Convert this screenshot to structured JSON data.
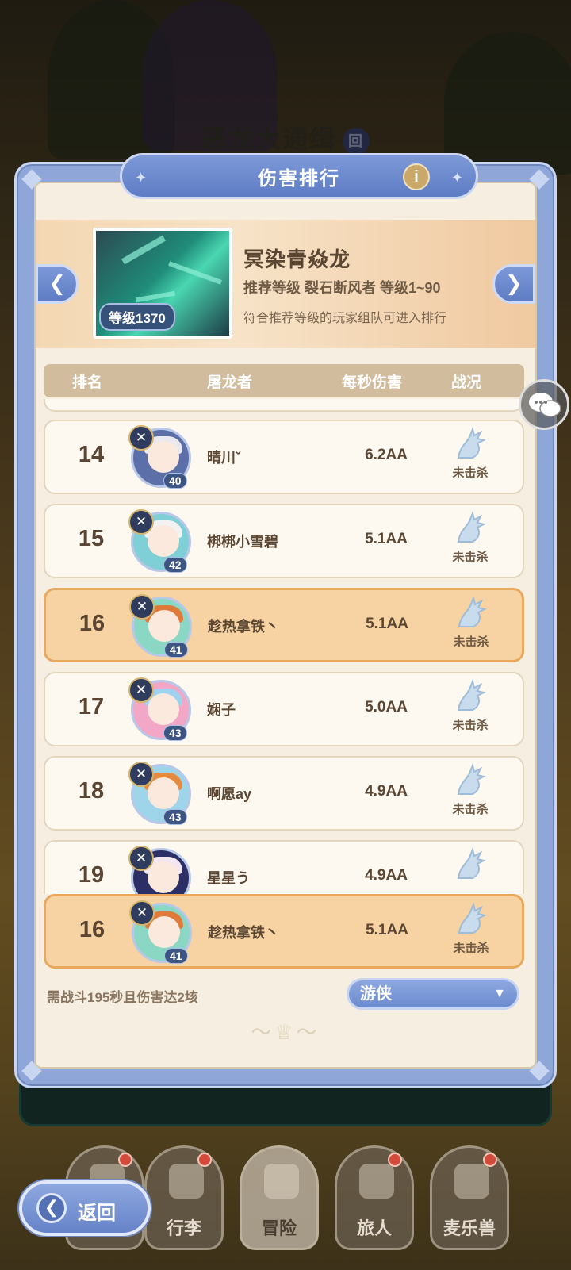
{
  "background": {
    "title": "恶龙大通缉",
    "badge": "回"
  },
  "modal": {
    "title": "伤害排行",
    "info_icon": "info-icon",
    "boss": {
      "name": "冥染青焱龙",
      "level_label": "等级1370",
      "recommend": "推荐等级  裂石断风者  等级1~90",
      "note": "符合推荐等级的玩家组队可进入排行"
    },
    "table_headers": {
      "rank": "排名",
      "player": "屠龙者",
      "dps": "每秒伤害",
      "status": "战况"
    },
    "rows": [
      {
        "rank": "14",
        "name": "晴川ˇ",
        "level": "40",
        "dps": "6.2AA",
        "status": "未击杀",
        "highlight": false,
        "hair": "#e9e9ef",
        "ring": "#5c6fa8"
      },
      {
        "rank": "15",
        "name": "梆梆小雪碧",
        "level": "42",
        "dps": "5.1AA",
        "status": "未击杀",
        "highlight": false,
        "hair": "#f2f2f2",
        "ring": "#7fcfd6"
      },
      {
        "rank": "16",
        "name": "趁热拿铁丶",
        "level": "41",
        "dps": "5.1AA",
        "status": "未击杀",
        "highlight": true,
        "hair": "#e07a3a",
        "ring": "#8ad8c4"
      },
      {
        "rank": "17",
        "name": "娴子",
        "level": "43",
        "dps": "5.0AA",
        "status": "未击杀",
        "highlight": false,
        "hair": "#9fd2ee",
        "ring": "#f2a7c6"
      },
      {
        "rank": "18",
        "name": "啊愿ay",
        "level": "43",
        "dps": "4.9AA",
        "status": "未击杀",
        "highlight": false,
        "hair": "#e68a3e",
        "ring": "#9fd5ea"
      },
      {
        "rank": "19",
        "name": "星星う",
        "level": "",
        "dps": "4.9AA",
        "status": "",
        "highlight": false,
        "hair": "#f1e6f2",
        "ring": "#2c2f66"
      }
    ],
    "my_row": {
      "rank": "16",
      "name": "趁热拿铁丶",
      "level": "41",
      "dps": "5.1AA",
      "status": "未击杀"
    },
    "requirement": "需战斗195秒且伤害达2垓",
    "class_select": "游侠"
  },
  "bottom_nav": {
    "back": "返回",
    "tabs": [
      {
        "label": "",
        "icon": "castle-icon",
        "dot": true
      },
      {
        "label": "行李",
        "icon": "chest-icon",
        "dot": true
      },
      {
        "label": "冒险",
        "icon": "crossed-swords-icon",
        "dot": false,
        "active": true
      },
      {
        "label": "旅人",
        "icon": "traveler-icon",
        "dot": true
      },
      {
        "label": "麦乐兽",
        "icon": "pet-icon",
        "dot": true
      }
    ]
  },
  "colors": {
    "accent": "#6f8ccf",
    "highlight_row": "#f7d3a3",
    "panel": "#f6efe1"
  }
}
